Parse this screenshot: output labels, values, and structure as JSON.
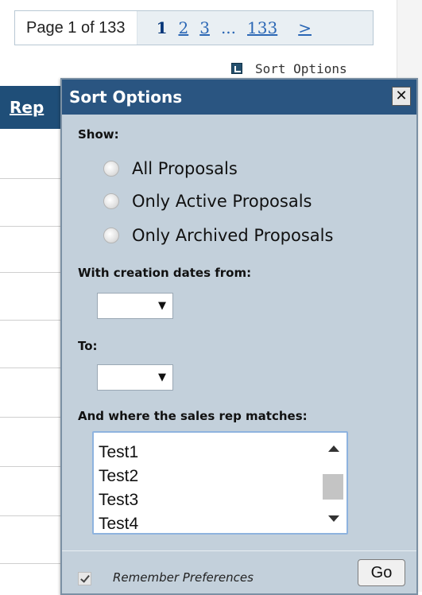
{
  "pager": {
    "page_text": "Page 1 of 133",
    "current": "1",
    "pages": [
      "2",
      "3"
    ],
    "ellipsis": "...",
    "last": "133",
    "next": ">"
  },
  "sort_link": {
    "label": "Sort Options",
    "icon": "expand-icon"
  },
  "table": {
    "header": "Rep"
  },
  "dialog": {
    "title": "Sort Options",
    "close": "✕",
    "show_label": "Show:",
    "radios": [
      "All Proposals",
      "Only Active Proposals",
      "Only Archived Proposals"
    ],
    "from_label": "With creation dates from:",
    "from_value": "",
    "to_label": "To:",
    "to_value": "",
    "rep_label": "And where the sales rep matches:",
    "reps": [
      "Test1",
      "Test2",
      "Test3",
      "Test4"
    ],
    "remember_label": "Remember Preferences",
    "remember_checked": true,
    "go_label": "Go"
  },
  "colors": {
    "title_bar": "#2a5581",
    "dialog_bg": "#c3d0db",
    "link": "#2b67b5",
    "table_header": "#1f4e78"
  }
}
